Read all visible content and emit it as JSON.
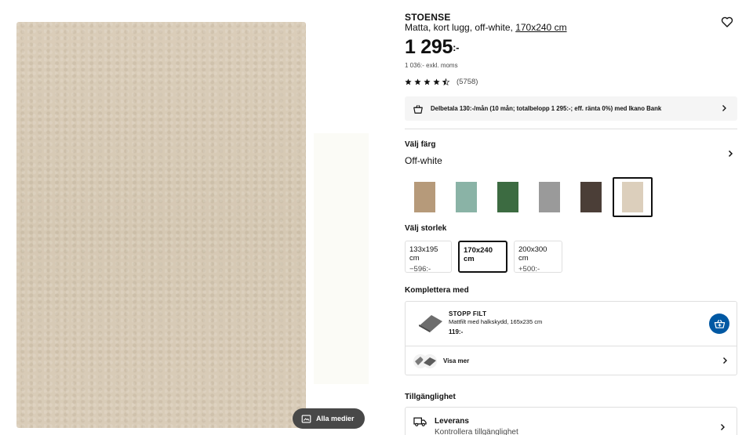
{
  "media": {
    "all_media_label": "Alla medier",
    "rug_color": "#d8cbb7"
  },
  "product": {
    "name": "STOENSE",
    "description": "Matta, kort lugg, off-white,",
    "size": "170x240 cm",
    "price_main": "1 295",
    "price_suffix": ":-",
    "price_ex_vat": "1 036:-",
    "price_ex_vat_label": "exkl. moms",
    "rating": 4.5,
    "rating_count": "(5758)"
  },
  "finance": {
    "text": "Delbetala 130:-/mån (10 mån; totalbelopp 1 295:-; eff. ränta 0%) med Ikano Bank"
  },
  "color": {
    "label": "Välj färg",
    "selected": "Off-white",
    "swatches": [
      {
        "name": "beige-brown",
        "color": "#b69a7a"
      },
      {
        "name": "light-green",
        "color": "#8ab3a6"
      },
      {
        "name": "dark-green",
        "color": "#3c6b41"
      },
      {
        "name": "grey",
        "color": "#9a9a9a"
      },
      {
        "name": "dark-brown",
        "color": "#4b3e37"
      },
      {
        "name": "off-white",
        "color": "#dccfbc"
      }
    ]
  },
  "size": {
    "label": "Välj storlek",
    "options": [
      {
        "size": "133x195 cm",
        "delta": "−596:-"
      },
      {
        "size": "170x240 cm",
        "delta": ""
      },
      {
        "size": "200x300 cm",
        "delta": "+500:-"
      }
    ]
  },
  "complement": {
    "label": "Komplettera med",
    "product_name": "STOPP FILT",
    "product_desc": "Mattfilt med halkskydd, 165x235 cm",
    "product_price": "119:-",
    "more_label": "Visa mer"
  },
  "availability": {
    "label": "Tillgänglighet",
    "delivery_title": "Leverans",
    "delivery_sub": "Kontrollera tillgänglighet"
  },
  "accent": "#0058a3"
}
